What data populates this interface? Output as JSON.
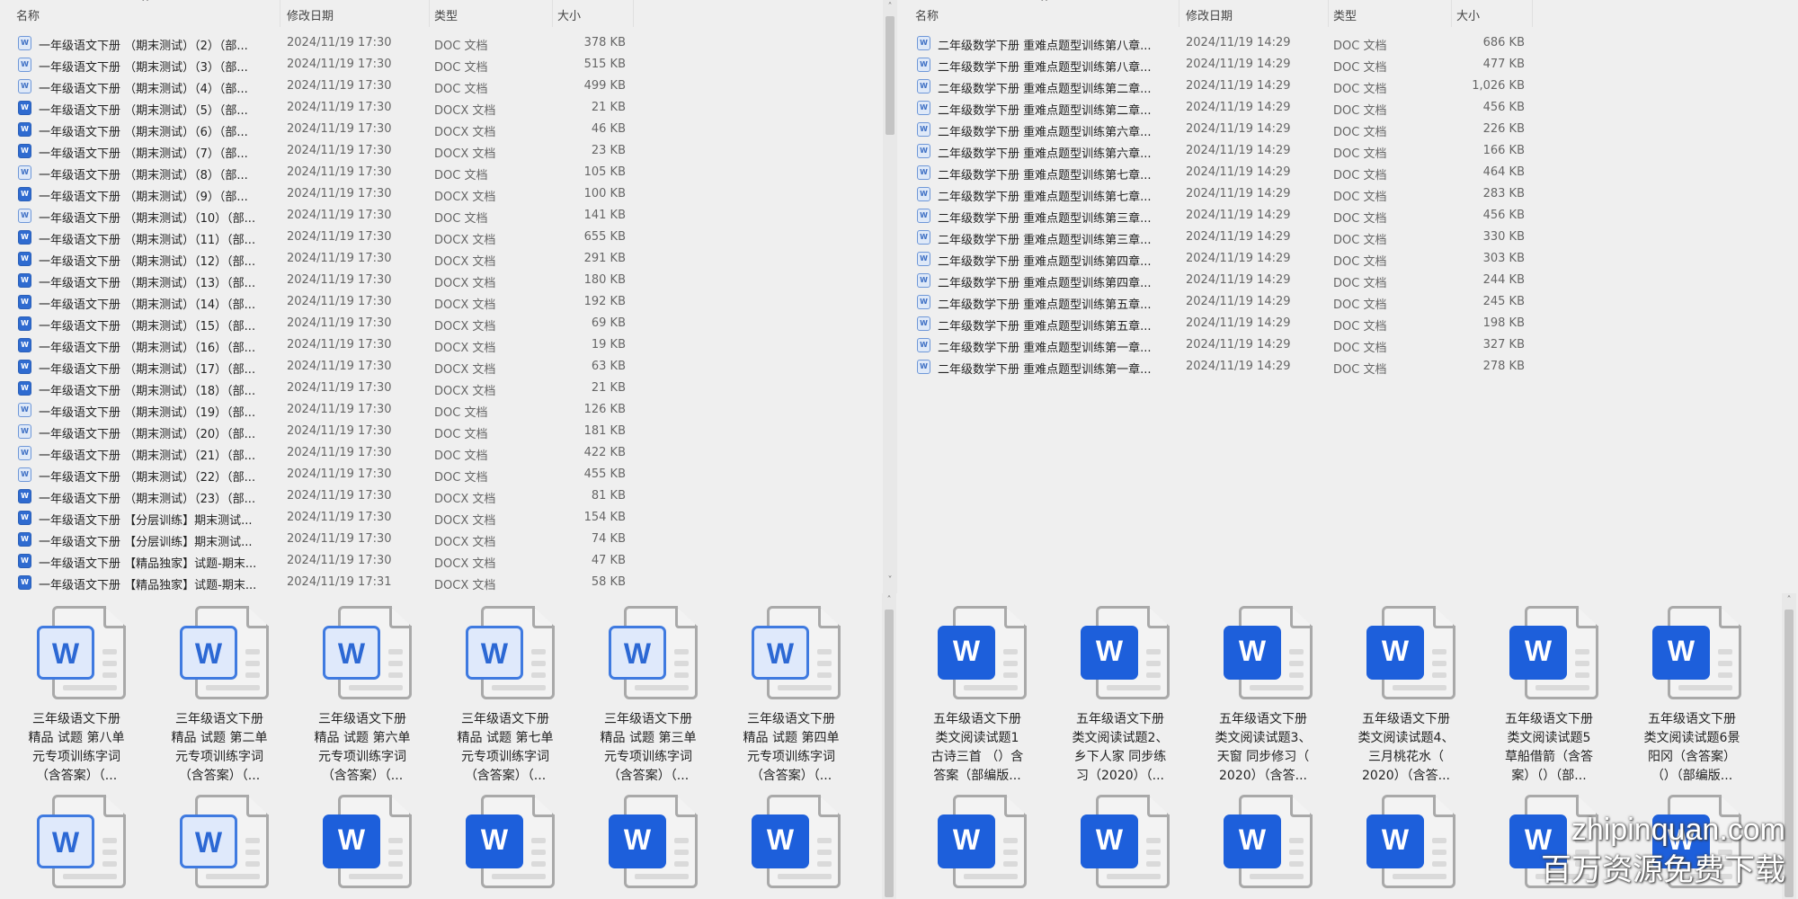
{
  "headers": {
    "name": "名称",
    "date": "修改日期",
    "type": "类型",
    "size": "大小"
  },
  "top_left": {
    "rows": [
      {
        "name": "一年级语文下册  （期末测试）（2）（部...",
        "date": "2024/11/19 17:30",
        "type": "DOC 文档",
        "size": "378 KB"
      },
      {
        "name": "一年级语文下册  （期末测试）（3）（部...",
        "date": "2024/11/19 17:30",
        "type": "DOC 文档",
        "size": "515 KB"
      },
      {
        "name": "一年级语文下册  （期末测试）（4）（部...",
        "date": "2024/11/19 17:30",
        "type": "DOC 文档",
        "size": "499 KB"
      },
      {
        "name": "一年级语文下册  （期末测试）（5）（部...",
        "date": "2024/11/19 17:30",
        "type": "DOCX 文档",
        "size": "21 KB"
      },
      {
        "name": "一年级语文下册  （期末测试）（6）（部...",
        "date": "2024/11/19 17:30",
        "type": "DOCX 文档",
        "size": "46 KB"
      },
      {
        "name": "一年级语文下册  （期末测试）（7）（部...",
        "date": "2024/11/19 17:30",
        "type": "DOCX 文档",
        "size": "23 KB"
      },
      {
        "name": "一年级语文下册  （期末测试）（8）（部...",
        "date": "2024/11/19 17:30",
        "type": "DOC 文档",
        "size": "105 KB"
      },
      {
        "name": "一年级语文下册  （期末测试）（9）（部...",
        "date": "2024/11/19 17:30",
        "type": "DOCX 文档",
        "size": "100 KB"
      },
      {
        "name": "一年级语文下册  （期末测试）（10）（部...",
        "date": "2024/11/19 17:30",
        "type": "DOC 文档",
        "size": "141 KB"
      },
      {
        "name": "一年级语文下册  （期末测试）（11）（部...",
        "date": "2024/11/19 17:30",
        "type": "DOCX 文档",
        "size": "655 KB"
      },
      {
        "name": "一年级语文下册  （期末测试）（12）（部...",
        "date": "2024/11/19 17:30",
        "type": "DOCX 文档",
        "size": "291 KB"
      },
      {
        "name": "一年级语文下册  （期末测试）（13）（部...",
        "date": "2024/11/19 17:30",
        "type": "DOCX 文档",
        "size": "180 KB"
      },
      {
        "name": "一年级语文下册  （期末测试）（14）（部...",
        "date": "2024/11/19 17:30",
        "type": "DOCX 文档",
        "size": "192 KB"
      },
      {
        "name": "一年级语文下册  （期末测试）（15）（部...",
        "date": "2024/11/19 17:30",
        "type": "DOCX 文档",
        "size": "69 KB"
      },
      {
        "name": "一年级语文下册  （期末测试）（16）（部...",
        "date": "2024/11/19 17:30",
        "type": "DOCX 文档",
        "size": "19 KB"
      },
      {
        "name": "一年级语文下册  （期末测试）（17）（部...",
        "date": "2024/11/19 17:30",
        "type": "DOCX 文档",
        "size": "63 KB"
      },
      {
        "name": "一年级语文下册  （期末测试）（18）（部...",
        "date": "2024/11/19 17:30",
        "type": "DOCX 文档",
        "size": "21 KB"
      },
      {
        "name": "一年级语文下册  （期末测试）（19）（部...",
        "date": "2024/11/19 17:30",
        "type": "DOC 文档",
        "size": "126 KB"
      },
      {
        "name": "一年级语文下册  （期末测试）（20）（部...",
        "date": "2024/11/19 17:30",
        "type": "DOC 文档",
        "size": "181 KB"
      },
      {
        "name": "一年级语文下册  （期末测试）（21）（部...",
        "date": "2024/11/19 17:30",
        "type": "DOC 文档",
        "size": "422 KB"
      },
      {
        "name": "一年级语文下册  （期末测试）（22）（部...",
        "date": "2024/11/19 17:30",
        "type": "DOC 文档",
        "size": "455 KB"
      },
      {
        "name": "一年级语文下册  （期末测试）（23）（部...",
        "date": "2024/11/19 17:30",
        "type": "DOCX 文档",
        "size": "81 KB"
      },
      {
        "name": "一年级语文下册 【分层训练】期末测试...",
        "date": "2024/11/19 17:30",
        "type": "DOCX 文档",
        "size": "154 KB"
      },
      {
        "name": "一年级语文下册 【分层训练】期末测试...",
        "date": "2024/11/19 17:30",
        "type": "DOCX 文档",
        "size": "74 KB"
      },
      {
        "name": "一年级语文下册 【精品独家】试题-期末...",
        "date": "2024/11/19 17:30",
        "type": "DOCX 文档",
        "size": "47 KB"
      },
      {
        "name": "一年级语文下册 【精品独家】试题-期末...",
        "date": "2024/11/19 17:31",
        "type": "DOCX 文档",
        "size": "58 KB"
      }
    ]
  },
  "top_right": {
    "rows": [
      {
        "name": "二年级数学下册  重难点题型训练第八章...",
        "date": "2024/11/19 14:29",
        "type": "DOC 文档",
        "size": "686 KB"
      },
      {
        "name": "二年级数学下册  重难点题型训练第八章...",
        "date": "2024/11/19 14:29",
        "type": "DOC 文档",
        "size": "477 KB"
      },
      {
        "name": "二年级数学下册  重难点题型训练第二章...",
        "date": "2024/11/19 14:29",
        "type": "DOC 文档",
        "size": "1,026 KB"
      },
      {
        "name": "二年级数学下册  重难点题型训练第二章...",
        "date": "2024/11/19 14:29",
        "type": "DOC 文档",
        "size": "456 KB"
      },
      {
        "name": "二年级数学下册  重难点题型训练第六章...",
        "date": "2024/11/19 14:29",
        "type": "DOC 文档",
        "size": "226 KB"
      },
      {
        "name": "二年级数学下册  重难点题型训练第六章...",
        "date": "2024/11/19 14:29",
        "type": "DOC 文档",
        "size": "166 KB"
      },
      {
        "name": "二年级数学下册  重难点题型训练第七章...",
        "date": "2024/11/19 14:29",
        "type": "DOC 文档",
        "size": "464 KB"
      },
      {
        "name": "二年级数学下册  重难点题型训练第七章...",
        "date": "2024/11/19 14:29",
        "type": "DOC 文档",
        "size": "283 KB"
      },
      {
        "name": "二年级数学下册  重难点题型训练第三章...",
        "date": "2024/11/19 14:29",
        "type": "DOC 文档",
        "size": "456 KB"
      },
      {
        "name": "二年级数学下册  重难点题型训练第三章...",
        "date": "2024/11/19 14:29",
        "type": "DOC 文档",
        "size": "330 KB"
      },
      {
        "name": "二年级数学下册  重难点题型训练第四章...",
        "date": "2024/11/19 14:29",
        "type": "DOC 文档",
        "size": "303 KB"
      },
      {
        "name": "二年级数学下册  重难点题型训练第四章...",
        "date": "2024/11/19 14:29",
        "type": "DOC 文档",
        "size": "244 KB"
      },
      {
        "name": "二年级数学下册  重难点题型训练第五章...",
        "date": "2024/11/19 14:29",
        "type": "DOC 文档",
        "size": "245 KB"
      },
      {
        "name": "二年级数学下册  重难点题型训练第五章...",
        "date": "2024/11/19 14:29",
        "type": "DOC 文档",
        "size": "198 KB"
      },
      {
        "name": "二年级数学下册  重难点题型训练第一章...",
        "date": "2024/11/19 14:29",
        "type": "DOC 文档",
        "size": "327 KB"
      },
      {
        "name": "二年级数学下册  重难点题型训练第一章...",
        "date": "2024/11/19 14:29",
        "type": "DOC 文档",
        "size": "278 KB"
      }
    ]
  },
  "bottom_left": {
    "tiles": [
      {
        "lines": [
          "三年级语文下册",
          "精品 试题 第八单",
          "元专项训练字词",
          "（含答案）（..."
        ],
        "style": "old"
      },
      {
        "lines": [
          "三年级语文下册",
          "精品 试题 第二单",
          "元专项训练字词",
          "（含答案）（..."
        ],
        "style": "old"
      },
      {
        "lines": [
          "三年级语文下册",
          "精品 试题 第六单",
          "元专项训练字词",
          "（含答案）（..."
        ],
        "style": "old"
      },
      {
        "lines": [
          "三年级语文下册",
          "精品 试题 第七单",
          "元专项训练字词",
          "（含答案）（..."
        ],
        "style": "old"
      },
      {
        "lines": [
          "三年级语文下册",
          "精品 试题 第三单",
          "元专项训练字词",
          "（含答案）（..."
        ],
        "style": "old"
      },
      {
        "lines": [
          "三年级语文下册",
          "精品 试题 第四单",
          "元专项训练字词",
          "（含答案）（..."
        ],
        "style": "old"
      },
      {
        "lines": [],
        "style": "old"
      },
      {
        "lines": [],
        "style": "old"
      },
      {
        "lines": [],
        "style": "new"
      },
      {
        "lines": [],
        "style": "new"
      },
      {
        "lines": [],
        "style": "new"
      },
      {
        "lines": [],
        "style": "new"
      }
    ]
  },
  "bottom_right": {
    "tiles": [
      {
        "lines": [
          "五年级语文下册",
          "类文阅读试题1",
          "古诗三首 （）含",
          "答案（部编版..."
        ],
        "style": "new"
      },
      {
        "lines": [
          "五年级语文下册",
          "类文阅读试题2、",
          "乡下人家 同步练",
          "习（2020）（..."
        ],
        "style": "new"
      },
      {
        "lines": [
          "五年级语文下册",
          "类文阅读试题3、",
          "天窗 同步修习（",
          "2020）（含答..."
        ],
        "style": "new"
      },
      {
        "lines": [
          "五年级语文下册",
          "类文阅读试题4、",
          "三月桃花水（",
          "2020）（含答..."
        ],
        "style": "new"
      },
      {
        "lines": [
          "五年级语文下册",
          "类文阅读试题5",
          "草船借箭（含答",
          "案）（）（部..."
        ],
        "style": "new"
      },
      {
        "lines": [
          "五年级语文下册",
          "类文阅读试题6景",
          "阳冈（含答案）",
          "（）（部编版..."
        ],
        "style": "new"
      },
      {
        "lines": [],
        "style": "new"
      },
      {
        "lines": [],
        "style": "new"
      },
      {
        "lines": [],
        "style": "new"
      },
      {
        "lines": [],
        "style": "new"
      },
      {
        "lines": [],
        "style": "new"
      },
      {
        "lines": [],
        "style": "new"
      }
    ]
  },
  "word_letter": "W",
  "watermark": {
    "line1": "zhipinquan.com",
    "line2": "百万资源免费下载"
  }
}
